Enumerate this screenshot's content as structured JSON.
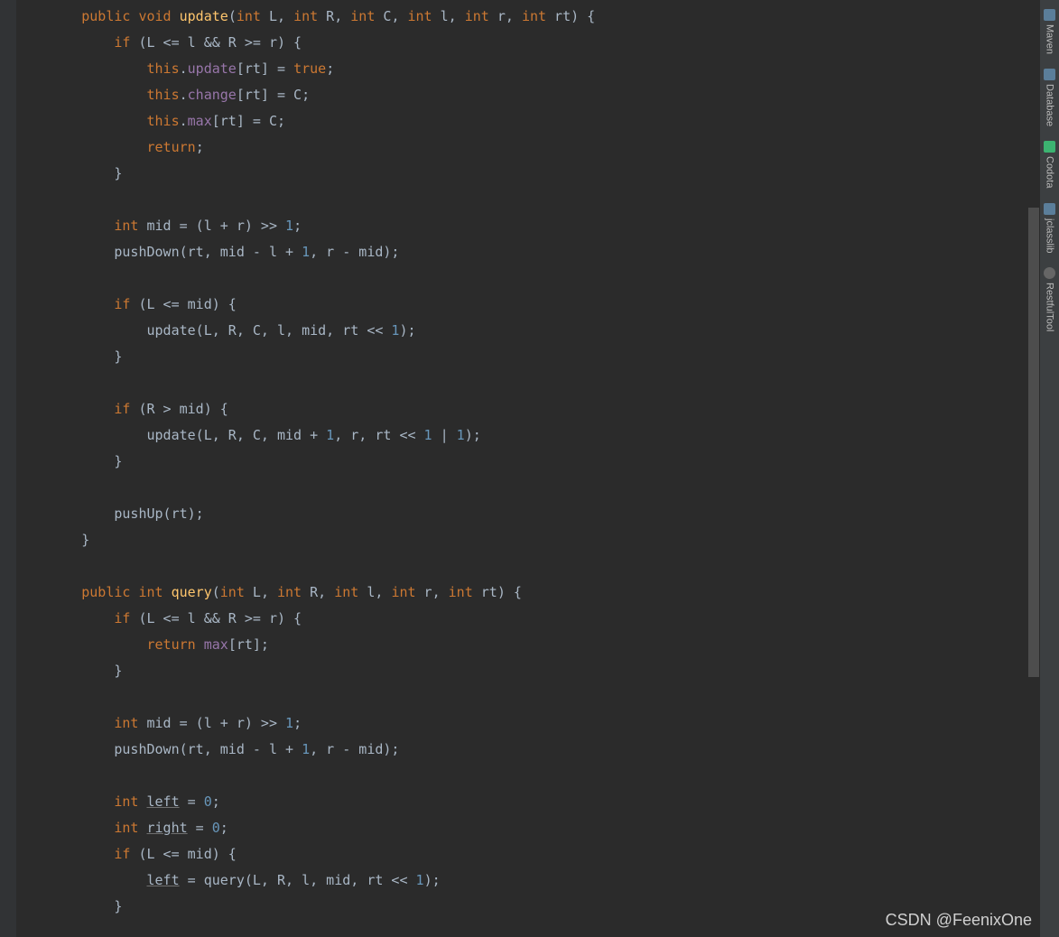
{
  "toolbar": {
    "items": [
      {
        "label": "Maven",
        "icon": "maven"
      },
      {
        "label": "Database",
        "icon": "db"
      },
      {
        "label": "Codota",
        "icon": "codota"
      },
      {
        "label": "jclasslib",
        "icon": "jclass"
      },
      {
        "label": "RestfulTool",
        "icon": "rest"
      }
    ]
  },
  "watermark": "CSDN @FeenixOne",
  "code": {
    "tokens": [
      [
        [
          "s",
          "        "
        ],
        [
          "kw",
          "public"
        ],
        [
          "s",
          " "
        ],
        [
          "kw",
          "void"
        ],
        [
          "s",
          " "
        ],
        [
          "method-decl",
          "update"
        ],
        [
          "punct",
          "("
        ],
        [
          "kw",
          "int"
        ],
        [
          "s",
          " L"
        ],
        [
          "punct",
          ","
        ],
        [
          "s",
          " "
        ],
        [
          "kw",
          "int"
        ],
        [
          "s",
          " R"
        ],
        [
          "punct",
          ","
        ],
        [
          "s",
          " "
        ],
        [
          "kw",
          "int"
        ],
        [
          "s",
          " C"
        ],
        [
          "punct",
          ","
        ],
        [
          "s",
          " "
        ],
        [
          "kw",
          "int"
        ],
        [
          "s",
          " l"
        ],
        [
          "punct",
          ","
        ],
        [
          "s",
          " "
        ],
        [
          "kw",
          "int"
        ],
        [
          "s",
          " r"
        ],
        [
          "punct",
          ","
        ],
        [
          "s",
          " "
        ],
        [
          "kw",
          "int"
        ],
        [
          "s",
          " rt"
        ],
        [
          "punct",
          ") {"
        ]
      ],
      [
        [
          "s",
          "            "
        ],
        [
          "kw",
          "if"
        ],
        [
          "s",
          " (L <= l && R >= r) {"
        ]
      ],
      [
        [
          "s",
          "                "
        ],
        [
          "this",
          "this"
        ],
        [
          "punct",
          "."
        ],
        [
          "field",
          "update"
        ],
        [
          "punct",
          "[rt] = "
        ],
        [
          "bool",
          "true"
        ],
        [
          "punct",
          ";"
        ]
      ],
      [
        [
          "s",
          "                "
        ],
        [
          "this",
          "this"
        ],
        [
          "punct",
          "."
        ],
        [
          "field",
          "change"
        ],
        [
          "punct",
          "[rt] = C;"
        ]
      ],
      [
        [
          "s",
          "                "
        ],
        [
          "this",
          "this"
        ],
        [
          "punct",
          "."
        ],
        [
          "field",
          "max"
        ],
        [
          "punct",
          "[rt] = C;"
        ]
      ],
      [
        [
          "s",
          "                "
        ],
        [
          "kw",
          "return"
        ],
        [
          "punct",
          ";"
        ]
      ],
      [
        [
          "s",
          "            }"
        ]
      ],
      [
        [
          "s",
          ""
        ]
      ],
      [
        [
          "s",
          "            "
        ],
        [
          "kw",
          "int"
        ],
        [
          "s",
          " mid = (l + r) >> "
        ],
        [
          "num",
          "1"
        ],
        [
          "punct",
          ";"
        ]
      ],
      [
        [
          "s",
          "            pushDown(rt, mid - l + "
        ],
        [
          "num",
          "1"
        ],
        [
          "punct",
          ", r - mid);"
        ]
      ],
      [
        [
          "s",
          ""
        ]
      ],
      [
        [
          "s",
          "            "
        ],
        [
          "kw",
          "if"
        ],
        [
          "s",
          " (L <= mid) {"
        ]
      ],
      [
        [
          "s",
          "                update(L, R, C, l, mid, rt << "
        ],
        [
          "num",
          "1"
        ],
        [
          "punct",
          ");"
        ]
      ],
      [
        [
          "s",
          "            }"
        ]
      ],
      [
        [
          "s",
          ""
        ]
      ],
      [
        [
          "s",
          "            "
        ],
        [
          "kw",
          "if"
        ],
        [
          "s",
          " (R > mid) {"
        ]
      ],
      [
        [
          "s",
          "                update(L, R, C, mid + "
        ],
        [
          "num",
          "1"
        ],
        [
          "punct",
          ", r, rt << "
        ],
        [
          "num",
          "1"
        ],
        [
          "s",
          " | "
        ],
        [
          "num",
          "1"
        ],
        [
          "punct",
          ");"
        ]
      ],
      [
        [
          "s",
          "            }"
        ]
      ],
      [
        [
          "s",
          ""
        ]
      ],
      [
        [
          "s",
          "            pushUp(rt);"
        ]
      ],
      [
        [
          "s",
          "        }"
        ]
      ],
      [
        [
          "s",
          ""
        ]
      ],
      [
        [
          "s",
          "        "
        ],
        [
          "kw",
          "public"
        ],
        [
          "s",
          " "
        ],
        [
          "kw",
          "int"
        ],
        [
          "s",
          " "
        ],
        [
          "method-decl",
          "query"
        ],
        [
          "punct",
          "("
        ],
        [
          "kw",
          "int"
        ],
        [
          "s",
          " L"
        ],
        [
          "punct",
          ","
        ],
        [
          "s",
          " "
        ],
        [
          "kw",
          "int"
        ],
        [
          "s",
          " R"
        ],
        [
          "punct",
          ","
        ],
        [
          "s",
          " "
        ],
        [
          "kw",
          "int"
        ],
        [
          "s",
          " l"
        ],
        [
          "punct",
          ","
        ],
        [
          "s",
          " "
        ],
        [
          "kw",
          "int"
        ],
        [
          "s",
          " r"
        ],
        [
          "punct",
          ","
        ],
        [
          "s",
          " "
        ],
        [
          "kw",
          "int"
        ],
        [
          "s",
          " rt"
        ],
        [
          "punct",
          ") {"
        ]
      ],
      [
        [
          "s",
          "            "
        ],
        [
          "kw",
          "if"
        ],
        [
          "s",
          " (L <= l && R >= r) {"
        ]
      ],
      [
        [
          "s",
          "                "
        ],
        [
          "kw",
          "return"
        ],
        [
          "s",
          " "
        ],
        [
          "field",
          "max"
        ],
        [
          "punct",
          "[rt];"
        ]
      ],
      [
        [
          "s",
          "            }"
        ]
      ],
      [
        [
          "s",
          ""
        ]
      ],
      [
        [
          "s",
          "            "
        ],
        [
          "kw",
          "int"
        ],
        [
          "s",
          " mid = (l + r) >> "
        ],
        [
          "num",
          "1"
        ],
        [
          "punct",
          ";"
        ]
      ],
      [
        [
          "s",
          "            pushDown(rt, mid - l + "
        ],
        [
          "num",
          "1"
        ],
        [
          "punct",
          ", r - mid);"
        ]
      ],
      [
        [
          "s",
          ""
        ]
      ],
      [
        [
          "s",
          "            "
        ],
        [
          "kw",
          "int"
        ],
        [
          "s",
          " "
        ],
        [
          "underline",
          "left"
        ],
        [
          "s",
          " = "
        ],
        [
          "num",
          "0"
        ],
        [
          "punct",
          ";"
        ]
      ],
      [
        [
          "s",
          "            "
        ],
        [
          "kw",
          "int"
        ],
        [
          "s",
          " "
        ],
        [
          "underline",
          "right"
        ],
        [
          "s",
          " = "
        ],
        [
          "num",
          "0"
        ],
        [
          "punct",
          ";"
        ]
      ],
      [
        [
          "s",
          "            "
        ],
        [
          "kw",
          "if"
        ],
        [
          "s",
          " (L <= mid) {"
        ]
      ],
      [
        [
          "s",
          "                "
        ],
        [
          "underline",
          "left"
        ],
        [
          "s",
          " = query(L, R, l, mid, rt << "
        ],
        [
          "num",
          "1"
        ],
        [
          "punct",
          ");"
        ]
      ],
      [
        [
          "s",
          "            }"
        ]
      ]
    ]
  }
}
